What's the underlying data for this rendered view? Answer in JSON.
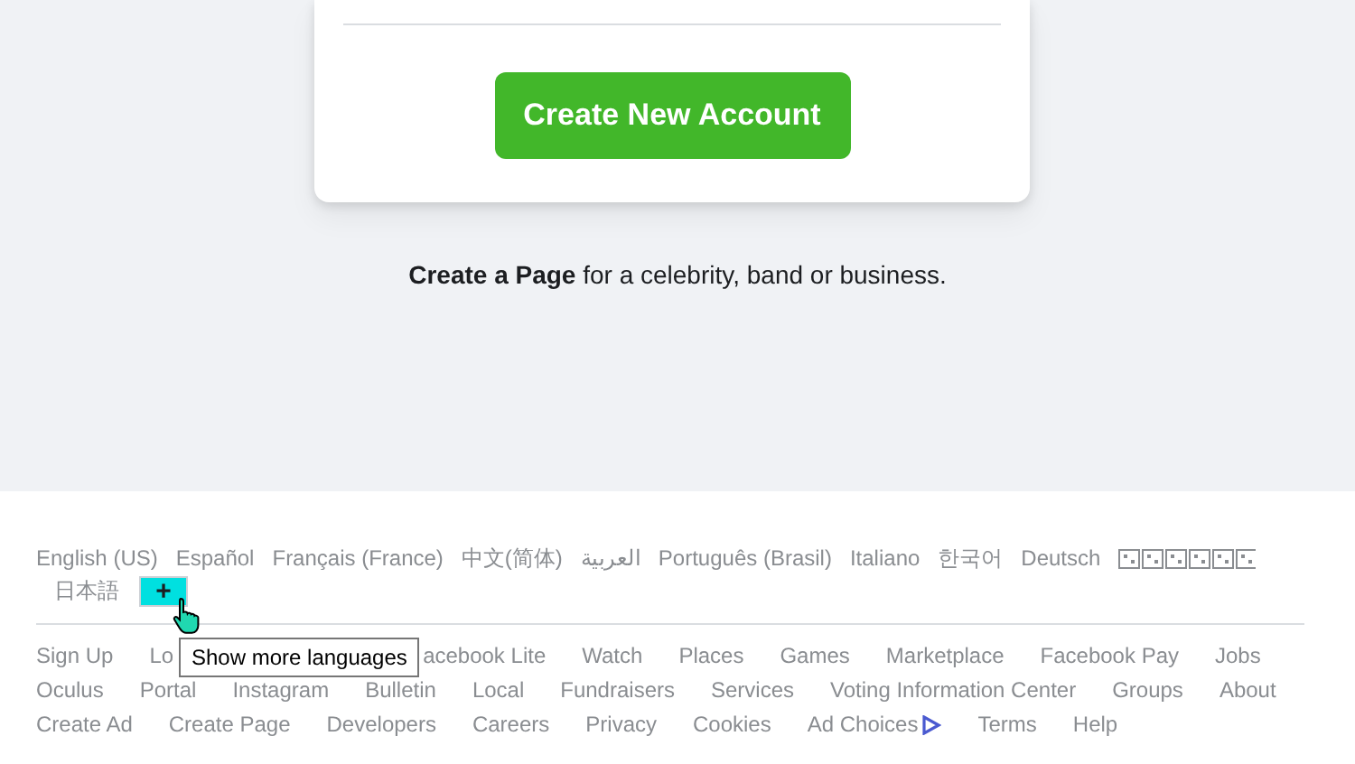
{
  "card": {
    "button": "Create New Account"
  },
  "create_page": "**Create a Page** for a celebrity, band or business.",
  "languages": [
    {
      "kind": "text",
      "label": "English (US)"
    },
    {
      "kind": "text",
      "label": "Español"
    },
    {
      "kind": "text",
      "label": "Français (France)"
    },
    {
      "kind": "text",
      "label": "中文(简体)"
    },
    {
      "kind": "text",
      "label": "العربية"
    },
    {
      "kind": "text",
      "label": "Português (Brasil)"
    },
    {
      "kind": "text",
      "label": "Italiano"
    },
    {
      "kind": "text",
      "label": "한국어"
    },
    {
      "kind": "text",
      "label": "Deutsch"
    },
    {
      "kind": "unrendered"
    },
    {
      "kind": "text",
      "label": "日本語"
    }
  ],
  "more_languages_button": "+",
  "tooltip": "Show more languages",
  "link_rows": [
    [
      {
        "label": "Sign Up"
      },
      {
        "label": "Lo"
      },
      {
        "label": "acebook Lite"
      },
      {
        "label": "Watch"
      },
      {
        "label": "Places"
      },
      {
        "label": "Games"
      },
      {
        "label": "Marketplace"
      },
      {
        "label": "Facebook Pay"
      },
      {
        "label": "Jobs"
      }
    ],
    [
      {
        "label": "Oculus"
      },
      {
        "label": "Portal"
      },
      {
        "label": "Instagram"
      },
      {
        "label": "Bulletin"
      },
      {
        "label": "Local"
      },
      {
        "label": "Fundraisers"
      },
      {
        "label": "Services"
      },
      {
        "label": "Voting Information Center"
      },
      {
        "label": "Groups"
      },
      {
        "label": "About"
      }
    ],
    [
      {
        "label": "Create Ad"
      },
      {
        "label": "Create Page"
      },
      {
        "label": "Developers"
      },
      {
        "label": "Careers"
      },
      {
        "label": "Privacy"
      },
      {
        "label": "Cookies"
      },
      {
        "label": "Ad Choices",
        "kind": "ad-choices"
      },
      {
        "label": "Terms"
      },
      {
        "label": "Help"
      }
    ]
  ]
}
